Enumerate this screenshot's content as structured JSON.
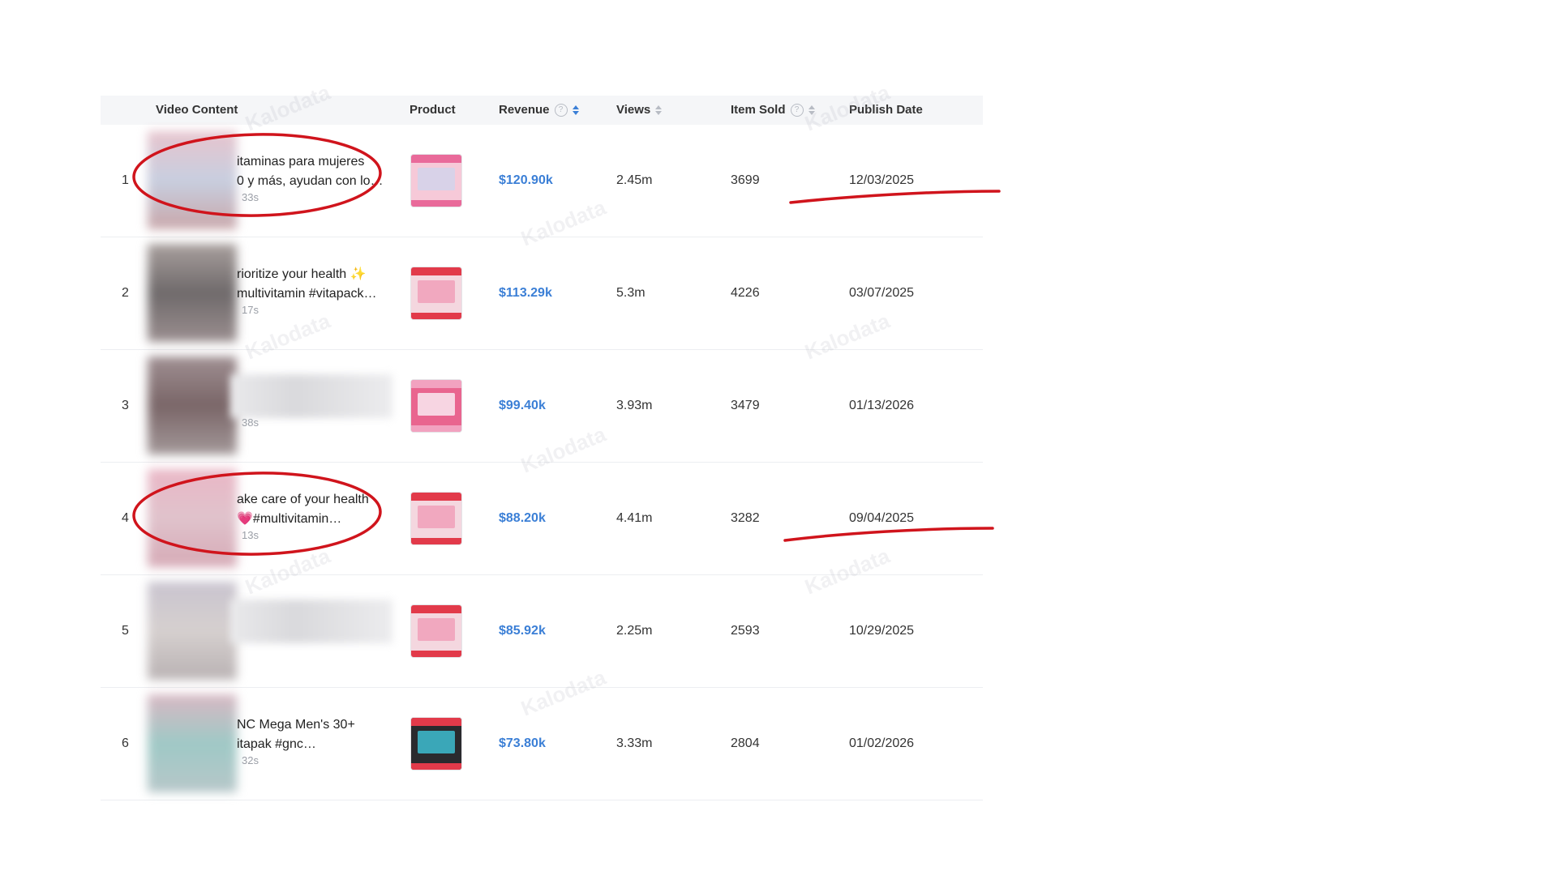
{
  "table": {
    "headers": {
      "video_content": "Video Content",
      "product": "Product",
      "revenue": "Revenue",
      "views": "Views",
      "item_sold": "Item Sold",
      "publish_date": "Publish Date"
    },
    "help_glyph": "?",
    "rows": [
      {
        "rank": "1",
        "text_line1": "itaminas para mujeres",
        "text_line2": "0 y más, ayudan con lo…",
        "duration": "33s",
        "revenue": "$120.90k",
        "views": "2.45m",
        "item_sold": "3699",
        "publish_date": "12/03/2025",
        "product_colors": [
          "#e96a9a",
          "#f6c9d8",
          "#d8d2e8"
        ],
        "thumb_colors": [
          "#e7c4cd",
          "#c8cfe0",
          "#c9a7aa"
        ]
      },
      {
        "rank": "2",
        "text_line1": "rioritize your health ✨",
        "text_line2": "multivitamin #vitapack…",
        "duration": "17s",
        "revenue": "$113.29k",
        "views": "5.3m",
        "item_sold": "4226",
        "publish_date": "03/07/2025",
        "product_colors": [
          "#e23a4a",
          "#f4d7df",
          "#f1a8bf"
        ],
        "thumb_colors": [
          "#a89f9d",
          "#6f6a6b",
          "#9b8f90"
        ]
      },
      {
        "rank": "3",
        "text_line1": "",
        "text_line2": "",
        "duration": "38s",
        "revenue": "$99.40k",
        "views": "3.93m",
        "item_sold": "3479",
        "publish_date": "01/13/2026",
        "product_colors": [
          "#f2a2c0",
          "#e9658f",
          "#f7d5e2"
        ],
        "thumb_colors": [
          "#9f8f92",
          "#7a6668",
          "#a39899"
        ]
      },
      {
        "rank": "4",
        "text_line1": "ake care of your health",
        "text_line2": "💗#multivitamin…",
        "duration": "13s",
        "revenue": "$88.20k",
        "views": "4.41m",
        "item_sold": "3282",
        "publish_date": "09/04/2025",
        "product_colors": [
          "#e23a4a",
          "#f4d7df",
          "#f1a8bf"
        ],
        "thumb_colors": [
          "#eab7c6",
          "#e0c3cc",
          "#d6aab6"
        ]
      },
      {
        "rank": "5",
        "text_line1": "",
        "text_line2": "",
        "duration": "",
        "revenue": "$85.92k",
        "views": "2.25m",
        "item_sold": "2593",
        "publish_date": "10/29/2025",
        "product_colors": [
          "#e23a4a",
          "#f4d7df",
          "#f1a8bf"
        ],
        "thumb_colors": [
          "#c9c4cf",
          "#d6d0cf",
          "#b9b2b3"
        ]
      },
      {
        "rank": "6",
        "text_line1": "NC Mega Men's 30+",
        "text_line2": "itapak #gnc…",
        "duration": "32s",
        "revenue": "$73.80k",
        "views": "3.33m",
        "item_sold": "2804",
        "publish_date": "01/02/2026",
        "product_colors": [
          "#e23a4a",
          "#2a2a2e",
          "#3aa7b8"
        ],
        "thumb_colors": [
          "#d8b8c3",
          "#9fc9c6",
          "#b7c7c9"
        ]
      }
    ]
  },
  "watermark_text": "Kalodata",
  "colors": {
    "link_blue": "#3b7fd6",
    "annotation_red": "#d0141c",
    "header_bg": "#f5f6f8"
  }
}
